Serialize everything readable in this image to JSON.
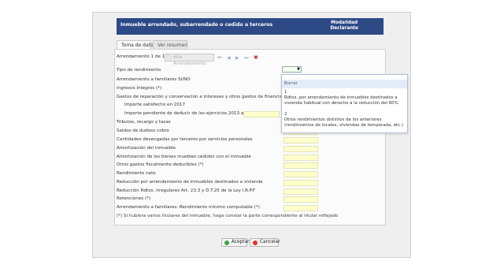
{
  "dialog": {
    "title": "Inmueble arrendado, subarrendado o cedido a terceros",
    "modalidad_line1": "Modalidad",
    "modalidad_line2": "Declarante"
  },
  "tabs": [
    {
      "label": "Toma de datos"
    },
    {
      "label": "Ver resumen"
    }
  ],
  "arrendamiento": {
    "counter": "Arrendamiento 1 de 1",
    "alta_label": "Alta Arrendamiento"
  },
  "rows": [
    "Tipo de rendimiento",
    "Arrendamiento a familiares SI/NO",
    "Ingresos íntegros (*)",
    "Gastos de reparación y conservación e intereses y otros gastos de financiación (*)",
    "Importe satisfecho en 2017",
    "Importe pendiente de deducir de los ejercicios 2013 a 2016",
    "Tributos, recargo y tasas",
    "Saldos de dudoso cobro",
    "Cantidades devengadas por terceros por servicios personales",
    "Amortización del inmueble",
    "Amortización de los bienes muebles cedidos con el inmueble",
    "Otros gastos fiscalmente deducibles (*)",
    "Rendimiento neto",
    "Reducción por arrendamiento de inmuebles destinados a vivienda",
    "Reducción Rdtos. irregulares Art. 23.3 y D.T.25 de la Ley I.R.P.F",
    "Retenciones (*)",
    "Arrendamiento a familiares: Rendimiento mínimo computable (*)"
  ],
  "footnote": "(*) Si hubiera varios titulares del inmueble, haga constar la parte correspondiente al titular reflejado",
  "dropdown": {
    "items": [
      {
        "label": "Borrar"
      },
      {
        "label": "1\nRdtos. por arrendamiento de inmuebles destinados a vivienda habitual con derecho a la reducción del 60%"
      },
      {
        "label": "2\nOtros rendimientos distintos de los anteriores (rendimientos de locales, viviendas de temporada, etc.)"
      }
    ]
  },
  "buttons": {
    "accept": "Aceptar",
    "cancel": "Cancelar"
  },
  "colors": {
    "title_bar": "#2d4a87",
    "field_fill": "#ffffcc"
  }
}
